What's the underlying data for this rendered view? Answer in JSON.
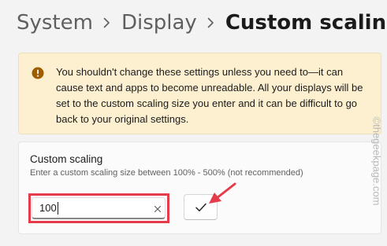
{
  "breadcrumb": {
    "items": [
      "System",
      "Display"
    ],
    "current": "Custom scaling"
  },
  "warning": {
    "text": "You shouldn't change these settings unless you need to—it can cause text and apps to become unreadable. All your displays will be set to the custom scaling size you enter and it can be difficult to go back to your original settings."
  },
  "custom_scaling": {
    "title": "Custom scaling",
    "description": "Enter a custom scaling size between 100% - 500% (not recommended)",
    "input_value": "100"
  },
  "watermark": "©thegeekpage.com",
  "colors": {
    "highlight": "#e53c4b",
    "warning_background": "#fcf0d0",
    "warning_icon": "#9d5d00"
  },
  "icons": {
    "warning": "info-circle-icon",
    "clear": "close-icon",
    "apply": "checkmark-icon",
    "separator": "chevron-right-icon"
  }
}
